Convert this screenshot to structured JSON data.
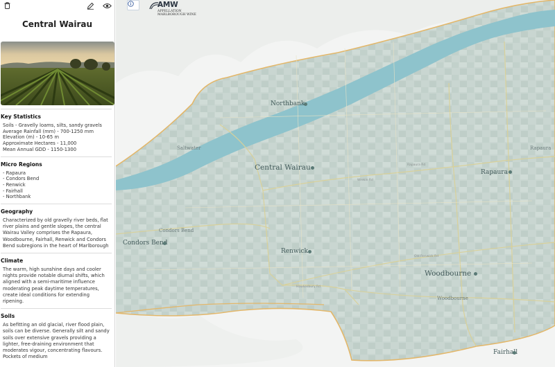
{
  "panel": {
    "title": "Central Wairau",
    "sections": {
      "key_statistics": {
        "title": "Key Statistics",
        "lines": [
          "Soils - Gravelly loams, silts, sandy gravels",
          "Average Rainfall (mm) - 700-1250 mm",
          "Elevation (m) - 10-65 m",
          "Approximate Hectares - 11,000",
          "Mean Annual GDD - 1150-1300"
        ]
      },
      "micro_regions": {
        "title": "Micro Regions",
        "items": [
          "- Rapaura",
          "- Condors Bend",
          "- Renwick",
          "- Fairhall",
          "- Northbank"
        ]
      },
      "geography": {
        "title": "Geography",
        "text": "Characterized by old gravelly river beds, flat river plains and gentle slopes, the central Wairau Valley comprises the Rapaura, Woodbourne, Fairhall, Renwick and Condors Bend subregions in the heart of Marlborough"
      },
      "climate": {
        "title": "Climate",
        "text": "The warm, high sunshine days and cooler nights provide notable diurnal shifts, which aligned with a semi-maritime influence moderating peak daytime temperatures, create ideal conditions for extending ripening."
      },
      "soils": {
        "title": "Soils",
        "text": "As befitting an old glacial, river flood plain, soils can be diverse. Generally silt and sandy soils over extensive gravels providing a lighter, free-draining environment that moderates vigour, concentrating flavours. Pockets of medium"
      }
    }
  },
  "icons": {
    "delete": "trash-icon",
    "edit": "pencil-icon",
    "view": "eye-icon",
    "info": "info-icon"
  },
  "map": {
    "logo": {
      "text": "AMW",
      "subtitle_1": "APPELLATION",
      "subtitle_2": "MARLBOROUGH WINE"
    },
    "places": [
      {
        "id": "northbank",
        "label": "Northbank"
      },
      {
        "id": "central-wairau",
        "label": "Central Wairau"
      },
      {
        "id": "rapaura",
        "label": "Rapaura"
      },
      {
        "id": "condors-bend",
        "label": "Condors Bend"
      },
      {
        "id": "renwick",
        "label": "Renwick"
      },
      {
        "id": "woodbourne",
        "label": "Woodbourne"
      },
      {
        "id": "fairhall",
        "label": "Fairhall"
      }
    ],
    "minor_labels": {
      "condors_bend_road": "Condors Bend",
      "rapaura_top_right": "Rapaura",
      "woodbourne_small": "Woodbourne",
      "west_small": "Saltwater"
    },
    "roads": {
      "rapaura_rd": "Rapaura Rd",
      "old_renwick_rd": "Old Renwick Rd",
      "hawkesbury_rd": "Hawkesbury Rd",
      "wrekin_rd": "Wrekin Rd"
    },
    "colors": {
      "river": "#8ec3cc",
      "valley": "#cdd9d4",
      "boundary": "#e3b76a",
      "hills": "#f4f5f4"
    }
  }
}
